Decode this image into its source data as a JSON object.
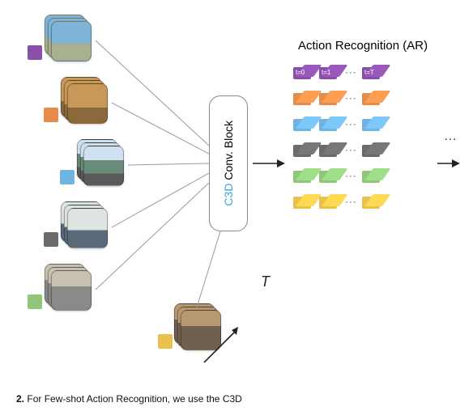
{
  "title": "Action Recognition (AR)",
  "block": {
    "c3d": "C3D",
    "rest": " Conv. Block"
  },
  "labels": {
    "colors": [
      "#8a4fa8",
      "#e58c4a",
      "#6fb3e0",
      "#6a6a6a",
      "#8fc77a",
      "#e8c24a"
    ]
  },
  "time": {
    "t0": "t=0",
    "t1": "t=1",
    "tT": "t=T",
    "T": "T"
  },
  "caption_prefix": "2.",
  "caption_rest": "For Few-shot Action Recognition, we use the C3D"
}
